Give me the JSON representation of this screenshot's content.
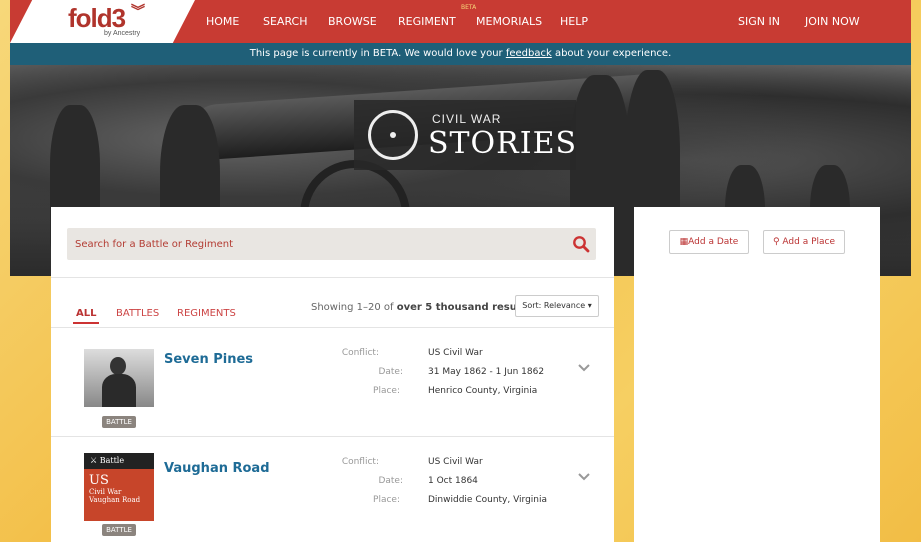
{
  "nav": {
    "logo": "fold3",
    "logo_sub": "by Ancestry",
    "items": [
      "HOME",
      "SEARCH",
      "BROWSE",
      "REGIMENT",
      "MEMORIALS",
      "HELP",
      "SIGN IN",
      "JOIN NOW"
    ],
    "beta_badge": "BETA"
  },
  "betabar": {
    "before": "This page is currently in BETA. We would love your ",
    "link": "feedback",
    "after": " about your experience."
  },
  "hero": {
    "small": "CIVIL WAR",
    "big": "STORIES"
  },
  "search": {
    "placeholder": "Search for a Battle or Regiment"
  },
  "tabs": [
    "ALL",
    "BATTLES",
    "REGIMENTS"
  ],
  "results": {
    "showing_prefix": "Showing 1–20 of ",
    "showing_bold": "over 5 thousand results",
    "sort": "Sort: Relevance ▾"
  },
  "rows": [
    {
      "title": "Seven Pines",
      "badge": "BATTLE",
      "labels": [
        "Conflict:",
        "Date:",
        "Place:"
      ],
      "values": [
        "US Civil War",
        "31 May 1862 - 1 Jun 1862",
        "Henrico County, Virginia"
      ]
    },
    {
      "title": "Vaughan Road",
      "badge": "BATTLE",
      "thumb_top": "⚔ Battle",
      "thumb_us": "US",
      "thumb_sub1": "Civil War",
      "thumb_sub2": "Vaughan Road",
      "labels": [
        "Conflict:",
        "Date:",
        "Place:"
      ],
      "values": [
        "US Civil War",
        "1 Oct 1864",
        "Dinwiddie County, Virginia"
      ]
    }
  ],
  "side": {
    "add_date": "Add a Date",
    "add_place": "Add a Place"
  },
  "colors": {
    "nav": "#c83b33",
    "betabar": "#1f5f78",
    "link": "#1e6b96"
  }
}
